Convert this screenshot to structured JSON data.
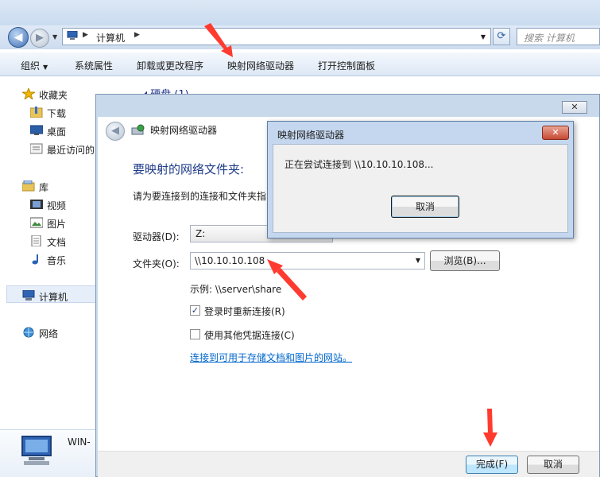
{
  "explorer": {
    "address_path": "计算机",
    "search_placeholder": "搜索 计算机",
    "commands": [
      "组织",
      "系统属性",
      "卸载或更改程序",
      "映射网络驱动器",
      "打开控制面板"
    ],
    "content_header": "◢ 硬盘 (1)",
    "sidebar": {
      "favorites": "收藏夹",
      "downloads": "下载",
      "desktop": "桌面",
      "recent": "最近访问的",
      "libraries": "库",
      "videos": "视频",
      "pictures": "图片",
      "documents": "文档",
      "music": "音乐",
      "computer": "计算机",
      "network": "网络"
    },
    "status_computer_name": "WIN-"
  },
  "wizard": {
    "window_title": "映射网络驱动器",
    "close_label": "✕",
    "heading": "要映射的网络文件夹:",
    "description": "请为要连接到的连接和文件夹指",
    "drive_label": "驱动器(D):",
    "drive_value": "Z:",
    "folder_label": "文件夹(O):",
    "folder_value": "\\\\10.10.10.108",
    "browse_label": "浏览(B)...",
    "example_text": "示例: \\\\server\\share",
    "reconnect_label": "登录时重新连接(R)",
    "reconnect_checked": true,
    "other_credentials_label": "使用其他凭据连接(C)",
    "other_credentials_checked": false,
    "link_text": "连接到可用于存储文档和图片的网站。",
    "finish_label": "完成(F)",
    "cancel_label": "取消"
  },
  "progress_dialog": {
    "title": "映射网络驱动器",
    "close_label": "✕",
    "message": "正在尝试连接到 \\\\10.10.10.108...",
    "cancel_label": "取消"
  },
  "colors": {
    "annotation_arrow": "#ff3b2f",
    "link": "#0066cc",
    "heading": "#1e3a8a"
  }
}
